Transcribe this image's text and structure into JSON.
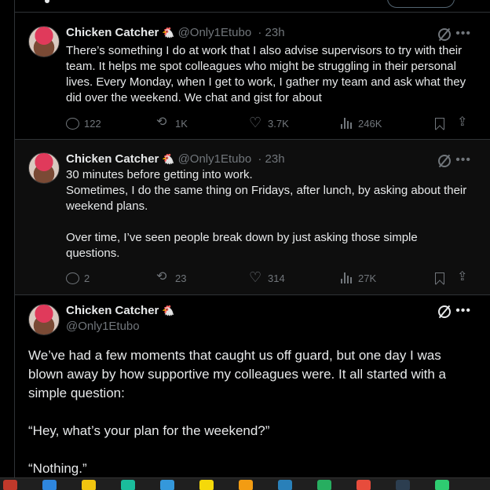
{
  "posts": [
    {
      "author": "Chicken Catcher",
      "badge": "🐔",
      "handle": "@Only1Etubo",
      "time": "· 23h",
      "text": "There’s something I do at work that I also advise supervisors to try with their team. It helps me spot colleagues who might be struggling in their personal lives. Every Monday, when I get to work, I gather my team and ask what they did over the weekend. We chat and gist for about",
      "replies": "122",
      "reposts": "1K",
      "likes": "3.7K",
      "views": "246K"
    },
    {
      "author": "Chicken Catcher",
      "badge": "🐔",
      "handle": "@Only1Etubo",
      "time": "· 23h",
      "text": "30 minutes before getting into work.\nSometimes, I do the same thing on Fridays, after lunch, by asking about their weekend plans.\n\nOver time, I’ve seen people break down by just asking those simple questions.",
      "replies": "2",
      "reposts": "23",
      "likes": "314",
      "views": "27K"
    }
  ],
  "main_post": {
    "author": "Chicken Catcher",
    "badge": "🐔",
    "handle": "@Only1Etubo",
    "text": "We’ve had a few moments that caught us off guard, but one day I was blown away by how supportive my colleagues were. It all started with a simple question:\n\n“Hey, what’s your plan for the weekend?”\n\n“Nothing.”"
  },
  "icons": {
    "more": "more-icon",
    "grok": "grok-icon",
    "reply": "reply-icon",
    "repost": "repost-icon",
    "like": "like-icon",
    "views": "views-icon",
    "bookmark": "bookmark-icon",
    "share": "share-icon"
  },
  "colors": {
    "background": "#000000",
    "text_primary": "#e7e9ea",
    "text_secondary": "#71767b",
    "border": "#2f3336"
  },
  "taskbar_colors": [
    "#c0392b",
    "#2e86de",
    "#f1c40f",
    "#1abc9c",
    "#3498db",
    "#f5d90a",
    "#f39c12",
    "#2980b9",
    "#27ae60",
    "#e74c3c",
    "#2c3e50",
    "#2ecc71"
  ]
}
